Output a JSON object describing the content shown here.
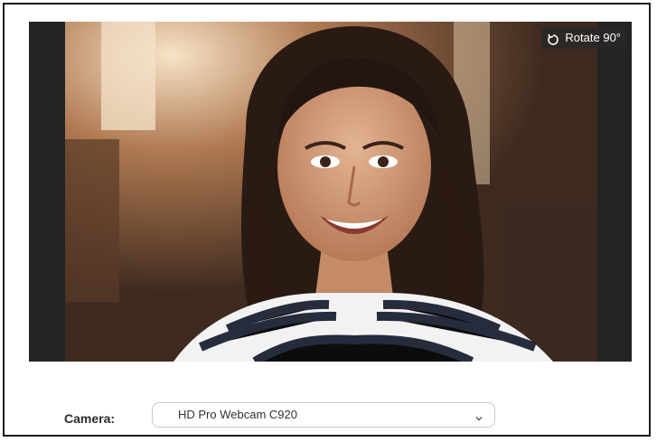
{
  "preview": {
    "rotate_label": "Rotate 90°",
    "rotate_icon": "rotate-icon"
  },
  "camera": {
    "label": "Camera:",
    "selected": "HD Pro Webcam C920",
    "dropdown_icon": "chevron-down-icon"
  }
}
